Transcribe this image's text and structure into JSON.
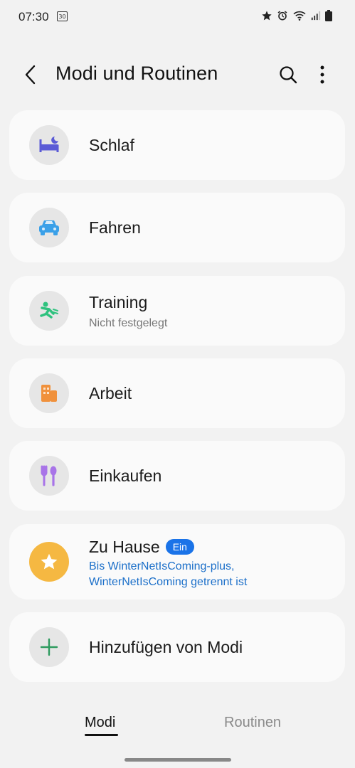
{
  "status_bar": {
    "time": "07:30",
    "notification_icon": "calendar-notification",
    "icons": [
      "star-icon",
      "alarm-icon",
      "wifi-icon",
      "signal-icon",
      "battery-icon"
    ]
  },
  "header": {
    "title": "Modi und Routinen",
    "back_icon": "chevron-left-icon",
    "search_icon": "search-icon",
    "more_icon": "more-vertical-icon"
  },
  "modes": [
    {
      "title": "Schlaf",
      "subtitle": "",
      "icon": "bed-icon",
      "icon_color": "#5b5bd6"
    },
    {
      "title": "Fahren",
      "subtitle": "",
      "icon": "car-icon",
      "icon_color": "#3aa0e8"
    },
    {
      "title": "Training",
      "subtitle": "Nicht festgelegt",
      "icon": "running-icon",
      "icon_color": "#2ec27e"
    },
    {
      "title": "Arbeit",
      "subtitle": "",
      "icon": "building-icon",
      "icon_color": "#f0913c"
    },
    {
      "title": "Einkaufen",
      "subtitle": "",
      "icon": "fork-spoon-icon",
      "icon_color": "#a874e8"
    },
    {
      "title": "Zu Hause",
      "badge": "Ein",
      "subtitle_line1": "Bis WinterNetIsComing-plus,",
      "subtitle_line2": "WinterNetIsComing getrennt ist",
      "icon": "star-icon",
      "icon_color": "#f5b842"
    }
  ],
  "add_mode": {
    "label": "Hinzufügen von Modi",
    "icon": "plus-icon",
    "icon_color": "#2e9b5f"
  },
  "tabs": [
    {
      "label": "Modi",
      "selected": true
    },
    {
      "label": "Routinen",
      "selected": false
    }
  ]
}
